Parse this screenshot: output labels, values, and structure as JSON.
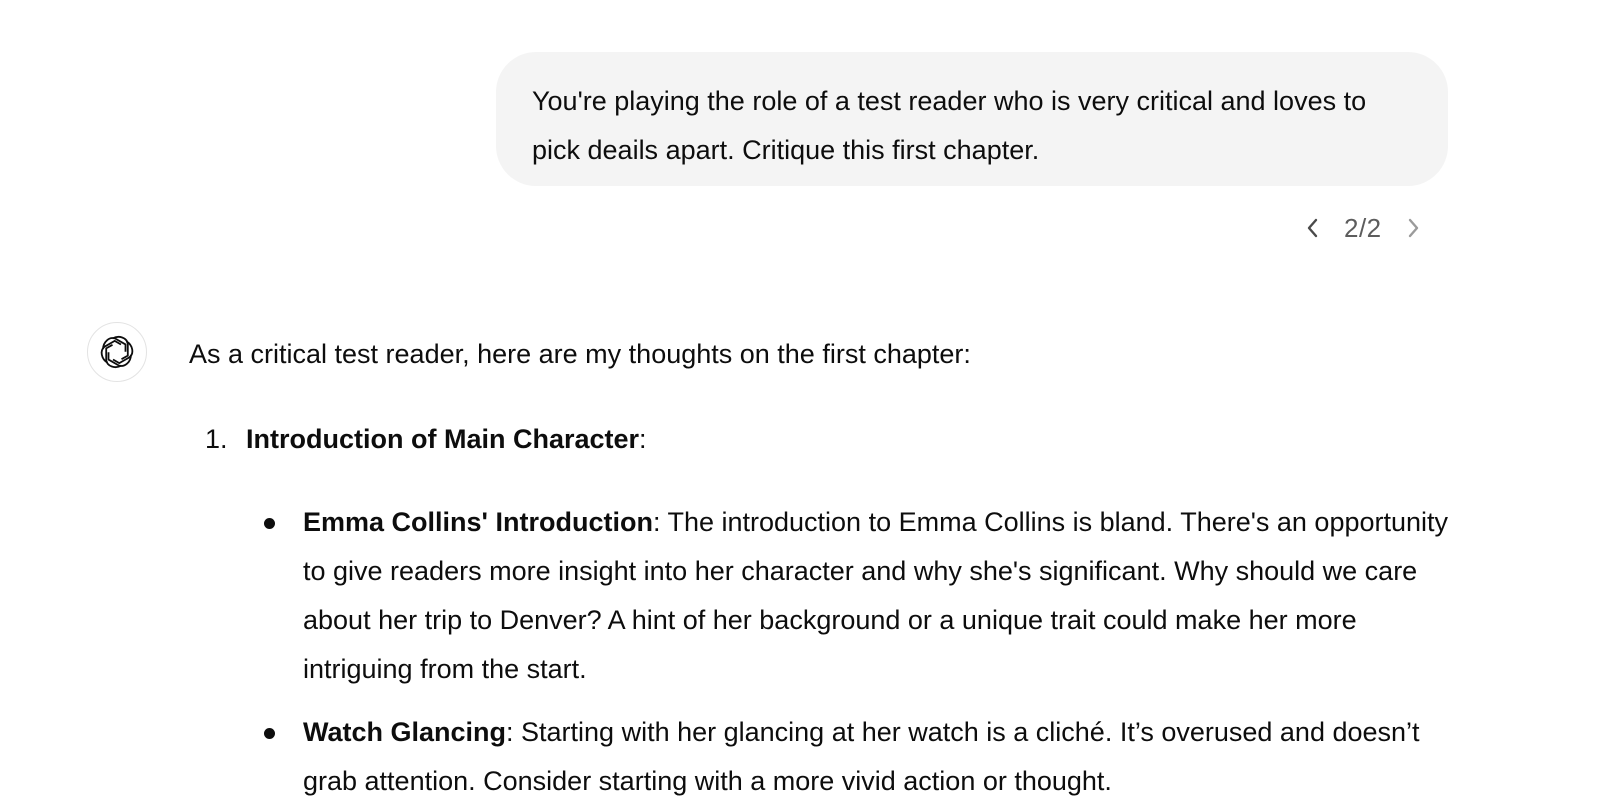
{
  "user_message": {
    "text": "You're playing the role of a test reader who is very critical and loves to pick deails apart. Critique this first chapter."
  },
  "pager": {
    "label": "2/2",
    "prev_icon": "chevron-left-icon",
    "next_icon": "chevron-right-icon"
  },
  "assistant": {
    "avatar_icon": "openai-logo-icon",
    "intro": "As a critical test reader, here are my thoughts on the first chapter:",
    "sections": [
      {
        "number": "1.",
        "title": "Introduction of Main Character",
        "title_suffix": ":",
        "bullets": [
          {
            "title": "Emma Collins' Introduction",
            "text": ": The introduction to Emma Collins is bland. There's an opportunity to give readers more insight into her character and why she's significant. Why should we care about her trip to Denver? A hint of her background or a unique trait could make her more intriguing from the start."
          },
          {
            "title": "Watch Glancing",
            "text": ": Starting with her glancing at her watch is a cliché. It’s overused and doesn’t grab attention. Consider starting with a more vivid action or thought."
          }
        ]
      }
    ]
  },
  "colors": {
    "bubble_bg": "#f4f4f4",
    "text": "#0d0d0d",
    "muted": "#5d5d5d"
  }
}
